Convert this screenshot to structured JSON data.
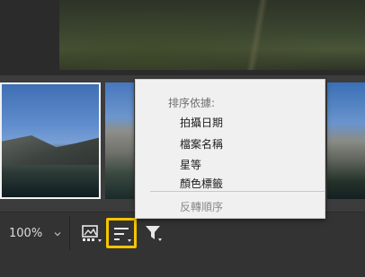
{
  "toolbar": {
    "zoom_value": "100%"
  },
  "icons": {
    "zoom_menu": "chevron-down-icon",
    "filter_view": "image-filter-icon",
    "sort": "sort-lines-icon",
    "filter": "funnel-icon"
  },
  "colors": {
    "highlight": "#f5c400",
    "menu_bg": "#f0f0f0"
  },
  "sort_menu": {
    "header": "排序依據:",
    "items": [
      "拍攝日期",
      "檔案名稱",
      "星等",
      "顏色標籤"
    ],
    "reverse": "反轉順序"
  }
}
